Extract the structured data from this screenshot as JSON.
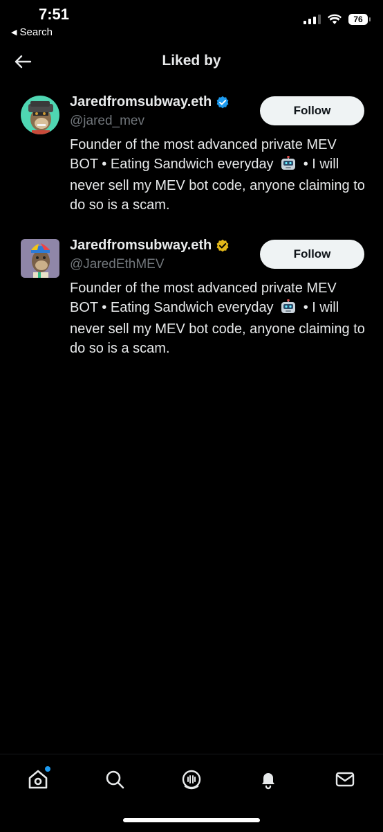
{
  "status_bar": {
    "time": "7:51",
    "back_label": "Search",
    "battery": "76"
  },
  "header": {
    "title": "Liked by"
  },
  "users": [
    {
      "name": "Jaredfromsubway.eth",
      "handle": "@jared_mev",
      "verified_badge_color": "#1d9bf0",
      "bio_before_emoji": "Founder of the most advanced private MEV BOT • Eating Sandwich everyday",
      "bio_emoji": "🤖",
      "bio_after_emoji": "• I will never sell my MEV bot code, anyone claiming to do so is a scam.",
      "follow_label": "Follow"
    },
    {
      "name": "Jaredfromsubway.eth",
      "handle": "@JaredEthMEV",
      "verified_badge_color": "#e2b719",
      "bio_before_emoji": "Founder of the most advanced private MEV BOT • Eating Sandwich everyday",
      "bio_emoji": "🤖",
      "bio_after_emoji": "• I will never sell my MEV bot code, anyone claiming to do so is a scam.",
      "follow_label": "Follow"
    }
  ],
  "tab_bar": {
    "items": [
      "home-icon",
      "search-icon",
      "spaces-icon",
      "notifications-icon",
      "messages-icon"
    ],
    "active": "home-icon"
  }
}
